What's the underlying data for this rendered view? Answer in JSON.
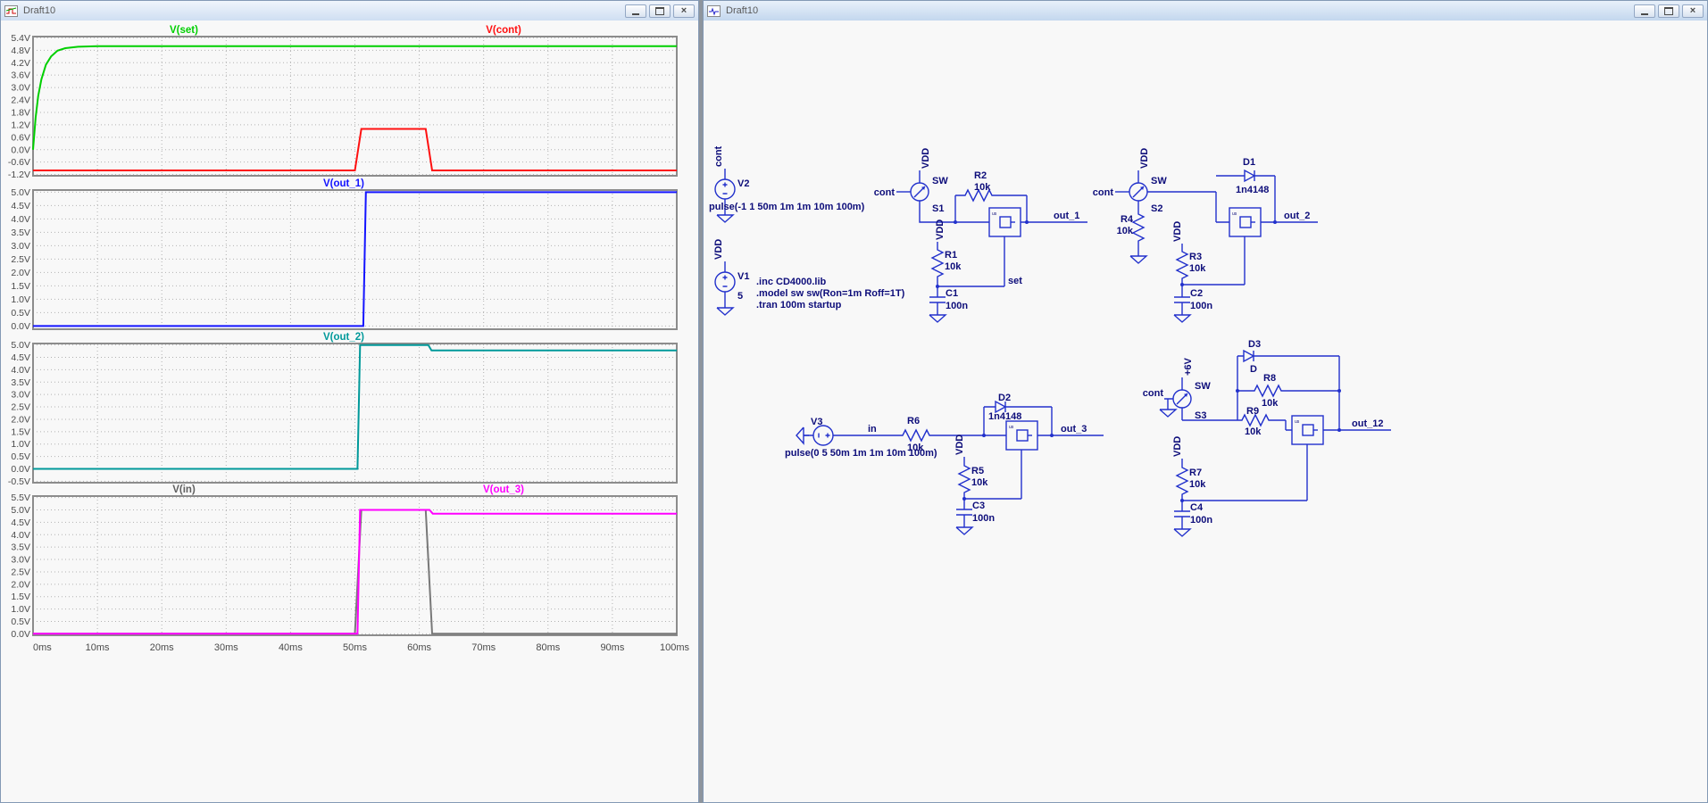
{
  "windows": {
    "left": {
      "title": "Draft10"
    },
    "right": {
      "title": "Draft10"
    }
  },
  "icons": {
    "close_glyph": "×"
  },
  "chart_data": [
    {
      "type": "line",
      "x_unit": "ms",
      "xlim": [
        0,
        100
      ],
      "ylim": [
        -1.26,
        5.46
      ],
      "grid": true,
      "yticks": [
        "5.4V",
        "4.8V",
        "4.2V",
        "3.6V",
        "3.0V",
        "2.4V",
        "1.8V",
        "1.2V",
        "0.6V",
        "0.0V",
        "-0.6V",
        "-1.2V"
      ],
      "titles": [
        {
          "text": "V(set)",
          "color": "#00cf00",
          "x": 205
        },
        {
          "text": "V(cont)",
          "color": "#ff1010",
          "x": 563
        }
      ],
      "series": [
        {
          "name": "V(set)",
          "color": "#00cf00",
          "points": [
            [
              0,
              0
            ],
            [
              0.4,
              1.55
            ],
            [
              0.8,
              2.6
            ],
            [
              1.3,
              3.4
            ],
            [
              2,
              4.1
            ],
            [
              2.8,
              4.5
            ],
            [
              3.8,
              4.78
            ],
            [
              5,
              4.9
            ],
            [
              7,
              4.97
            ],
            [
              10,
              5.0
            ],
            [
              100,
              5.0
            ]
          ]
        },
        {
          "name": "V(cont)",
          "color": "#ff1010",
          "points": [
            [
              0,
              -1
            ],
            [
              50,
              -1
            ],
            [
              51,
              1
            ],
            [
              61,
              1
            ],
            [
              62,
              -1
            ],
            [
              100,
              -1
            ]
          ]
        }
      ]
    },
    {
      "type": "line",
      "x_unit": "ms",
      "xlim": [
        0,
        100
      ],
      "ylim": [
        -0.12,
        5.08
      ],
      "grid": true,
      "yticks": [
        "5.0V",
        "4.5V",
        "4.0V",
        "3.5V",
        "3.0V",
        "2.5V",
        "2.0V",
        "1.5V",
        "1.0V",
        "0.5V",
        "0.0V"
      ],
      "titles": [
        {
          "text": "V(out_1)",
          "color": "#1414ff",
          "x": 384
        }
      ],
      "series": [
        {
          "name": "V(out_1)",
          "color": "#1414ff",
          "points": [
            [
              0,
              0
            ],
            [
              51.3,
              0
            ],
            [
              51.7,
              5
            ],
            [
              100,
              5
            ]
          ]
        }
      ]
    },
    {
      "type": "line",
      "x_unit": "ms",
      "xlim": [
        0,
        100
      ],
      "ylim": [
        -0.56,
        5.06
      ],
      "grid": true,
      "yticks": [
        "5.0V",
        "4.5V",
        "4.0V",
        "3.5V",
        "3.0V",
        "2.5V",
        "2.0V",
        "1.5V",
        "1.0V",
        "0.5V",
        "0.0V",
        "-0.5V"
      ],
      "titles": [
        {
          "text": "V(out_2)",
          "color": "#00999a",
          "x": 384
        }
      ],
      "series": [
        {
          "name": "V(out_2)",
          "color": "#00999a",
          "points": [
            [
              0,
              0
            ],
            [
              50.4,
              0
            ],
            [
              50.8,
              5
            ],
            [
              61.4,
              5
            ],
            [
              61.9,
              4.78
            ],
            [
              100,
              4.78
            ]
          ]
        }
      ]
    },
    {
      "type": "line",
      "x_unit": "ms",
      "xlim": [
        0,
        100
      ],
      "ylim": [
        -0.06,
        5.56
      ],
      "grid": true,
      "yticks": [
        "5.5V",
        "5.0V",
        "4.5V",
        "4.0V",
        "3.5V",
        "3.0V",
        "2.5V",
        "2.0V",
        "1.5V",
        "1.0V",
        "0.5V",
        "0.0V"
      ],
      "titles": [
        {
          "text": "V(in)",
          "color": "#5f5f5f",
          "x": 205
        },
        {
          "text": "V(out_3)",
          "color": "#ff00ff",
          "x": 563
        }
      ],
      "series": [
        {
          "name": "V(in)",
          "color": "#787878",
          "points": [
            [
              0,
              0
            ],
            [
              50,
              0
            ],
            [
              51,
              5
            ],
            [
              61,
              5
            ],
            [
              62,
              0
            ],
            [
              100,
              0
            ]
          ]
        },
        {
          "name": "V(out_3)",
          "color": "#ff00ff",
          "points": [
            [
              0,
              0
            ],
            [
              50.4,
              0
            ],
            [
              50.8,
              5
            ],
            [
              61.6,
              5
            ],
            [
              62.1,
              4.85
            ],
            [
              100,
              4.85
            ]
          ]
        }
      ],
      "xticks": [
        "0ms",
        "10ms",
        "20ms",
        "30ms",
        "40ms",
        "50ms",
        "60ms",
        "70ms",
        "80ms",
        "90ms",
        "100ms"
      ]
    }
  ],
  "schematic": {
    "directives": [
      ".inc CD4000.lib",
      ".model sw sw(Ron=1m Roff=1T)",
      ".tran 100m startup"
    ],
    "net": {
      "cont": "cont",
      "vdd": "VDD",
      "p6v": "+6V",
      "set": "set",
      "in": "in",
      "out1": "out_1",
      "out2": "out_2",
      "out3": "out_3",
      "out12": "out_12"
    },
    "v1": {
      "name": "V1",
      "value": "5"
    },
    "v2": {
      "name": "V2",
      "value": "pulse(-1 1 50m 1m 1m 10m 100m)"
    },
    "v3": {
      "name": "V3",
      "value": "pulse(0 5 50m 1m 1m 10m 100m)"
    },
    "s1": {
      "name": "S1",
      "model": "SW"
    },
    "s2": {
      "name": "S2",
      "model": "SW"
    },
    "s3": {
      "name": "S3",
      "model": "SW"
    },
    "r1": {
      "name": "R1",
      "value": "10k"
    },
    "r2": {
      "name": "R2",
      "value": "10k"
    },
    "r3": {
      "name": "R3",
      "value": "10k"
    },
    "r4": {
      "name": "R4",
      "value": "10k"
    },
    "r5": {
      "name": "R5",
      "value": "10k"
    },
    "r6": {
      "name": "R6",
      "value": "10k"
    },
    "r7": {
      "name": "R7",
      "value": "10k"
    },
    "r8": {
      "name": "R8",
      "value": "10k"
    },
    "r9": {
      "name": "R9",
      "value": "10k"
    },
    "c1": {
      "name": "C1",
      "value": "100n"
    },
    "c2": {
      "name": "C2",
      "value": "100n"
    },
    "c3": {
      "name": "C3",
      "value": "100n"
    },
    "c4": {
      "name": "C4",
      "value": "100n"
    },
    "d1": {
      "name": "D1",
      "value": "1n4148"
    },
    "d2": {
      "name": "D2",
      "value": "1n4148"
    },
    "d3": {
      "name": "D3",
      "value": "D"
    },
    "gate_tag": "us"
  }
}
